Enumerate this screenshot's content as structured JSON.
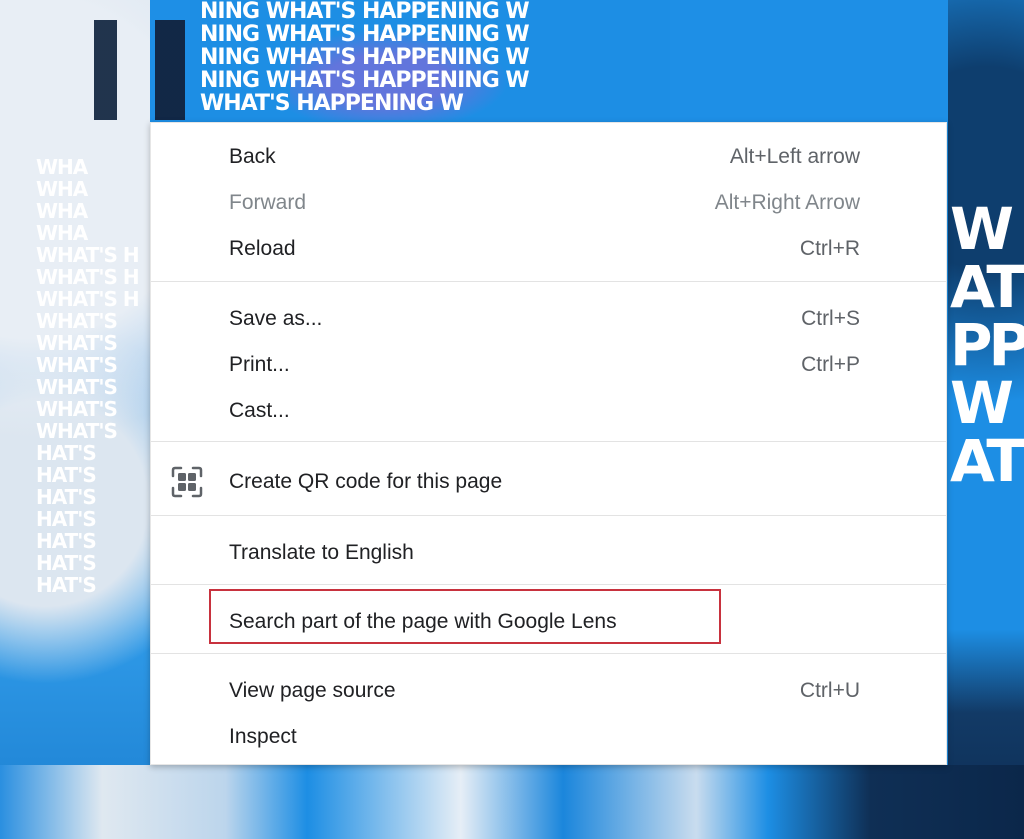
{
  "background": {
    "poster_text": "WHAT'S HAPPENING",
    "left_column_text": [
      "WHA",
      "WHA",
      "WHA",
      "WHA",
      "WHAT'S H",
      "WHAT'S H",
      "WHAT'S H",
      "WHAT'S",
      "WHAT'S",
      "WHAT'S",
      "WHAT'S",
      "WHAT'S",
      "WHAT'S",
      "HAT'S",
      "HAT'S",
      "HAT'S",
      "HAT'S",
      "HAT'S",
      "HAT'S",
      "HAT'S"
    ],
    "top_text": [
      "NING WHAT'S HAPPENING W",
      "NING WHAT'S HAPPENING W",
      "NING WHAT'S HAPPENING W",
      "NING WHAT'S HAPPENING W",
      "WHAT'S HAPPENING W"
    ],
    "right_text": [
      "W",
      "AT",
      "PP",
      "W",
      "AT"
    ]
  },
  "context_menu": {
    "items": [
      {
        "label": "Back",
        "shortcut": "Alt+Left arrow",
        "enabled": true
      },
      {
        "label": "Forward",
        "shortcut": "Alt+Right Arrow",
        "enabled": false
      },
      {
        "label": "Reload",
        "shortcut": "Ctrl+R",
        "enabled": true
      },
      {
        "label": "Save as...",
        "shortcut": "Ctrl+S",
        "enabled": true
      },
      {
        "label": "Print...",
        "shortcut": "Ctrl+P",
        "enabled": true
      },
      {
        "label": "Cast...",
        "shortcut": "",
        "enabled": true
      },
      {
        "label": "Create QR code for this page",
        "shortcut": "",
        "enabled": true,
        "icon": "qr-code-icon"
      },
      {
        "label": "Translate to English",
        "shortcut": "",
        "enabled": true
      },
      {
        "label": "Search part of the page with Google Lens",
        "shortcut": "",
        "enabled": true,
        "highlighted": true
      },
      {
        "label": "View page source",
        "shortcut": "Ctrl+U",
        "enabled": true
      },
      {
        "label": "Inspect",
        "shortcut": "",
        "enabled": true
      }
    ]
  },
  "colors": {
    "highlight_border": "#c8323e",
    "menu_background": "#ffffff",
    "poster_blue": "#1d8ee4"
  }
}
